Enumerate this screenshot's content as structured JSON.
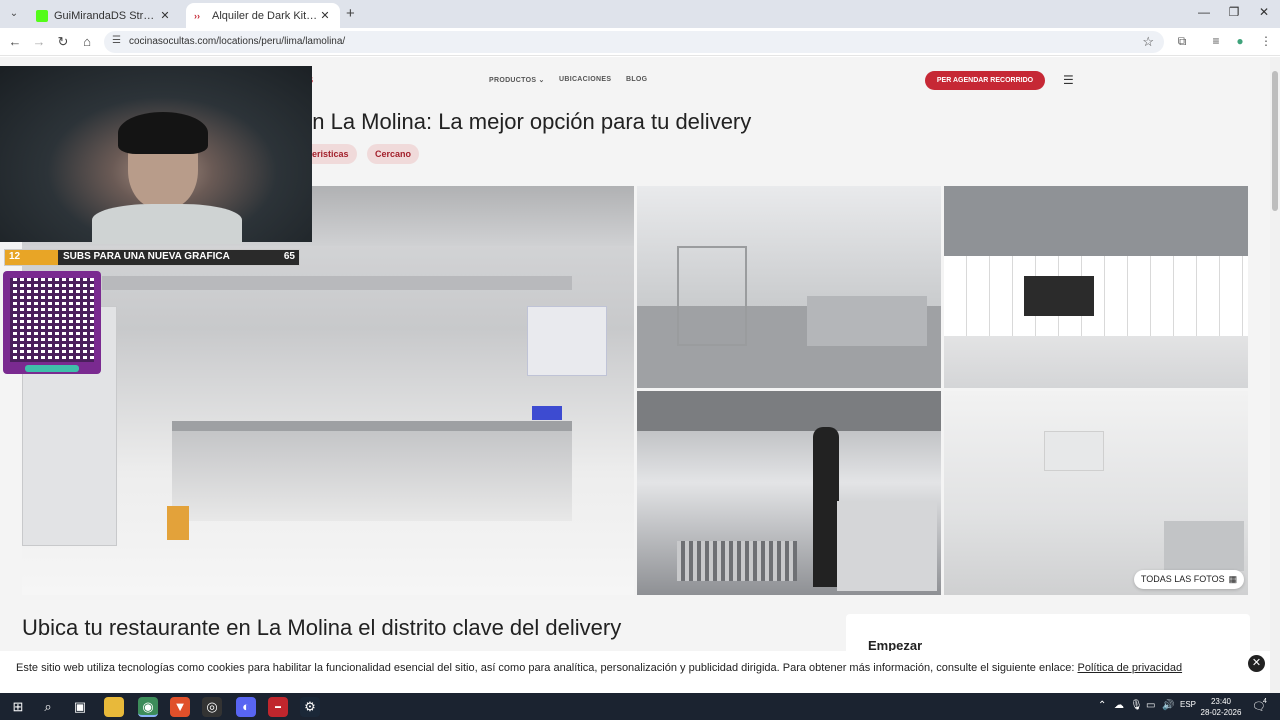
{
  "browser": {
    "tabs": [
      {
        "title": "GuiMirandaDS Stream - Watch",
        "active": false,
        "favicon_color": "#53fc18"
      },
      {
        "title": "Alquiler de Dark Kitchen en La M",
        "active": true,
        "favicon_color": "#c62835"
      }
    ],
    "url": "cocinasocultas.com/locations/peru/lima/lamolina/"
  },
  "site": {
    "logo_fragment": "as",
    "nav": [
      {
        "label": "PRODUCTOS ⌄"
      },
      {
        "label": "UBICACIONES"
      },
      {
        "label": "BLOG"
      }
    ],
    "cta": "PER AGENDAR RECORRIDO",
    "heading": "en La Molina: La mejor opción para tu delivery",
    "chips": [
      "cteristicas",
      "Cercano"
    ],
    "all_photos": "TODAS LAS FOTOS",
    "subheading": "Ubica tu restaurante en La Molina el distrito clave del delivery",
    "side_card_title": "Empezar"
  },
  "cookie": {
    "text": "Este sitio web utiliza tecnologías como cookies para habilitar la funcionalidad esencial del sitio, así como para analítica, personalización y publicidad dirigida. Para obtener más información, consulte el siguiente enlace:",
    "link": "Política de privacidad",
    "close": "✕"
  },
  "stream_overlay": {
    "goal_current": "12",
    "goal_label": "SUBS PARA UNA NUEVA GRAFICA",
    "goal_target": "65",
    "goal_progress": 0.18
  },
  "taskbar": {
    "language": "ESP",
    "time": "23:40",
    "date": "28-02-2026",
    "notification_count": "4"
  },
  "colors": {
    "brand_red": "#c62835",
    "chip_bg": "#f0dada",
    "taskbar": "#1b2330",
    "qr_purple": "#7a2a90"
  }
}
